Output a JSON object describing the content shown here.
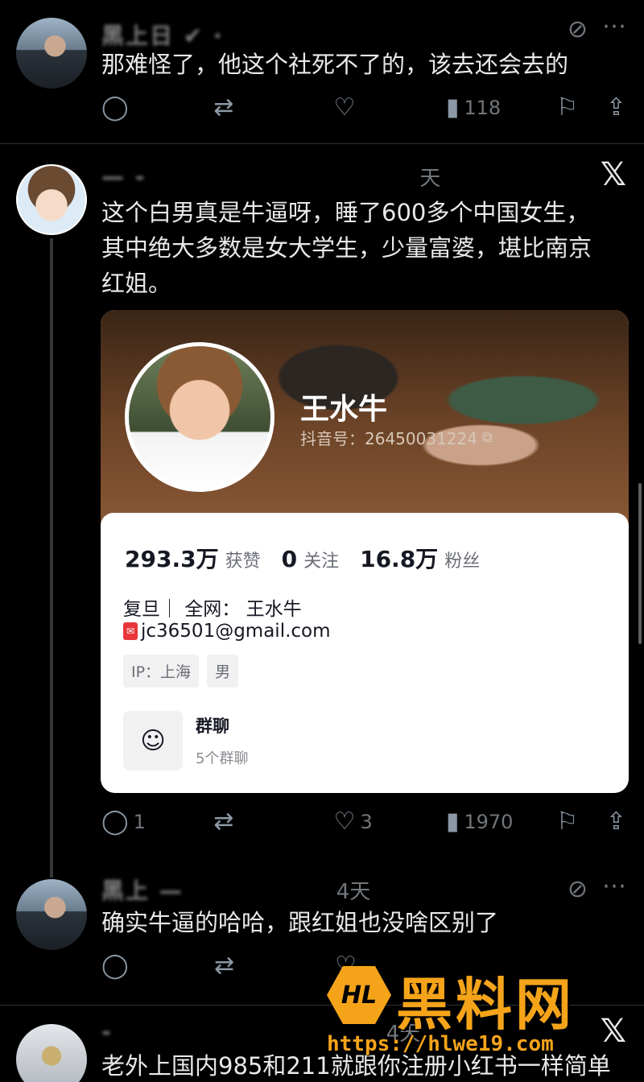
{
  "posts": [
    {
      "text": "那难怪了，他这个社死不了的，该去还会去的",
      "name_visible": "黑上日 ✔ ·",
      "time": "",
      "views": "118",
      "replies": "",
      "likes": ""
    },
    {
      "text_lines": [
        "这个白男真是牛逼呀，睡了600多个中国女生，",
        "其中绝大多数是女大学生，少量富婆，堪比南京",
        "红姐。"
      ],
      "name_visible": "— -",
      "time": "天",
      "replies": "1",
      "likes": "3",
      "views": "1970"
    },
    {
      "text": "确实牛逼的哈哈，跟红姐也没啥区别了",
      "name_visible": "黑上 —",
      "time": "4天"
    },
    {
      "text": "老外上国内985和211就跟你注册小红书一样简单",
      "name_visible": "-",
      "time": "4天"
    }
  ],
  "card": {
    "profile_name": "王水牛",
    "douyin_id": "抖音号：26450031224",
    "stats": [
      {
        "num": "293.3万",
        "label": "获赞"
      },
      {
        "num": "0",
        "label": "关注"
      },
      {
        "num": "16.8万",
        "label": "粉丝"
      }
    ],
    "bio_line1": "复旦｜ 全网：  王水牛",
    "email": "jc36501@gmail.com",
    "tags": [
      "IP：上海",
      "男"
    ],
    "group_title": "群聊",
    "group_sub": "5个群聊"
  },
  "watermark": {
    "logo": "HL",
    "title": "黑料网",
    "url": "https://hlwe19.com"
  },
  "icons": {
    "reply": "reply-icon",
    "retweet": "retweet-icon",
    "like": "like-icon",
    "views": "views-icon",
    "bookmark": "bookmark-icon",
    "share": "share-icon",
    "mute": "mute-icon",
    "x_logo": "x-logo-icon"
  },
  "colors": {
    "background": "#000000",
    "text": "#e7e9ea",
    "muted": "#71767b",
    "watermark": "#f5a41a"
  }
}
